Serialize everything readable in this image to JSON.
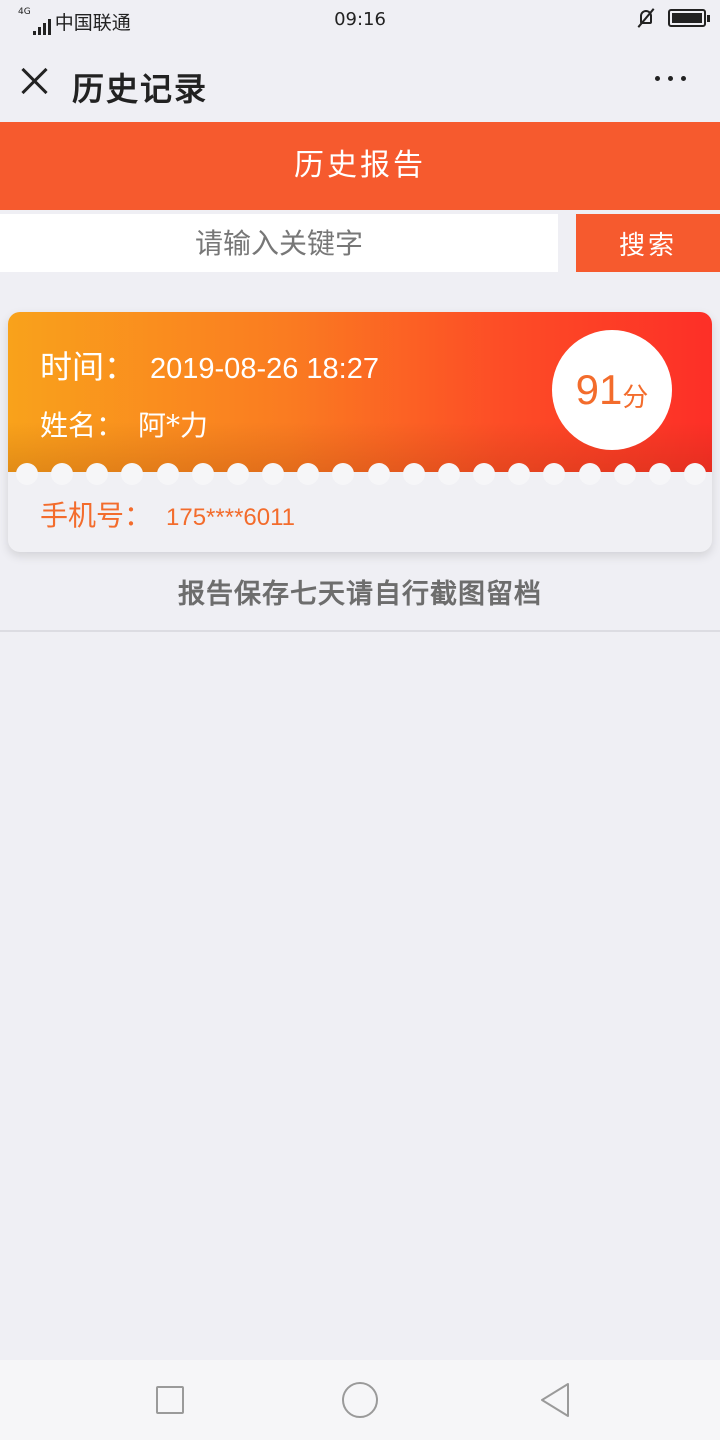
{
  "statusbar": {
    "network": "4G",
    "carrier": "中国联通",
    "time": "09:16"
  },
  "navbar": {
    "title": "历史记录"
  },
  "header": {
    "title": "历史报告"
  },
  "search": {
    "placeholder": "请输入关键字",
    "button_label": "搜索"
  },
  "report": {
    "time_label": "时间：",
    "time_value": "2019-08-26  18:27",
    "name_label": "姓名：",
    "name_value": "阿*力",
    "score_value": "91",
    "score_unit": "分",
    "phone_label": "手机号：",
    "phone_value": "175****6011"
  },
  "notice": "报告保存七天请自行截图留档",
  "colors": {
    "accent": "#f65a2e",
    "card_gradient_start": "#f9a21b",
    "card_gradient_end": "#fd2f27",
    "score_text": "#f36c2c",
    "background": "#efeff4"
  },
  "icons": {
    "close": "close-icon",
    "more": "more-icon",
    "mute": "mute-icon",
    "battery": "battery-icon",
    "signal": "signal-icon"
  }
}
